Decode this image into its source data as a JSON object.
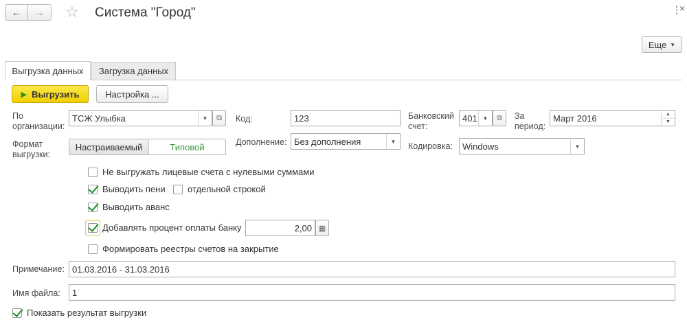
{
  "window": {
    "title": "Система \"Город\"",
    "nav_back": "←",
    "nav_forward": "→",
    "favorite_icon": "star-icon"
  },
  "toolbar": {
    "more_label": "Еще"
  },
  "tabs": [
    {
      "label": "Выгрузка данных",
      "active": true
    },
    {
      "label": "Загрузка данных",
      "active": false
    }
  ],
  "actions": {
    "export_label": "Выгрузить",
    "settings_label": "Настройка ..."
  },
  "form": {
    "org_label": "По организации:",
    "org_value": "ТСЖ Улыбка",
    "code_label": "Код:",
    "code_value": "123",
    "bank_label": "Банковский счет:",
    "bank_value": "401",
    "period_label": "За период:",
    "period_value": "Март 2016",
    "format_label": "Формат выгрузки:",
    "format_options": [
      "Настраиваемый",
      "Типовой"
    ],
    "format_selected": "Типовой",
    "addition_label": "Дополнение:",
    "addition_value": "Без дополнения",
    "encoding_label": "Кодировка:",
    "encoding_value": "Windows",
    "note_label": "Примечание:",
    "note_value": "01.03.2016 - 31.03.2016",
    "filename_label": "Имя файла:",
    "filename_value": "1"
  },
  "options": {
    "no_zero_accounts": {
      "label": "Не выгружать лицевые счета с нулевыми суммами",
      "checked": false
    },
    "show_penalty": {
      "label": "Выводить пени",
      "checked": true
    },
    "separate_line": {
      "label": "отдельной строкой",
      "checked": false
    },
    "show_advance": {
      "label": "Выводить аванс",
      "checked": true
    },
    "bank_percent": {
      "label": "Добавлять процент оплаты банку",
      "checked": true,
      "value": "2,00"
    },
    "closing_registers": {
      "label": "Формировать реестры счетов на закрытие",
      "checked": false
    },
    "show_result": {
      "label": "Показать результат выгрузки",
      "checked": true
    }
  },
  "colors": {
    "accent_yellow": "#f5d100",
    "check_green": "#1f8a1f",
    "toggle_selected_text": "#3a9a3a"
  }
}
